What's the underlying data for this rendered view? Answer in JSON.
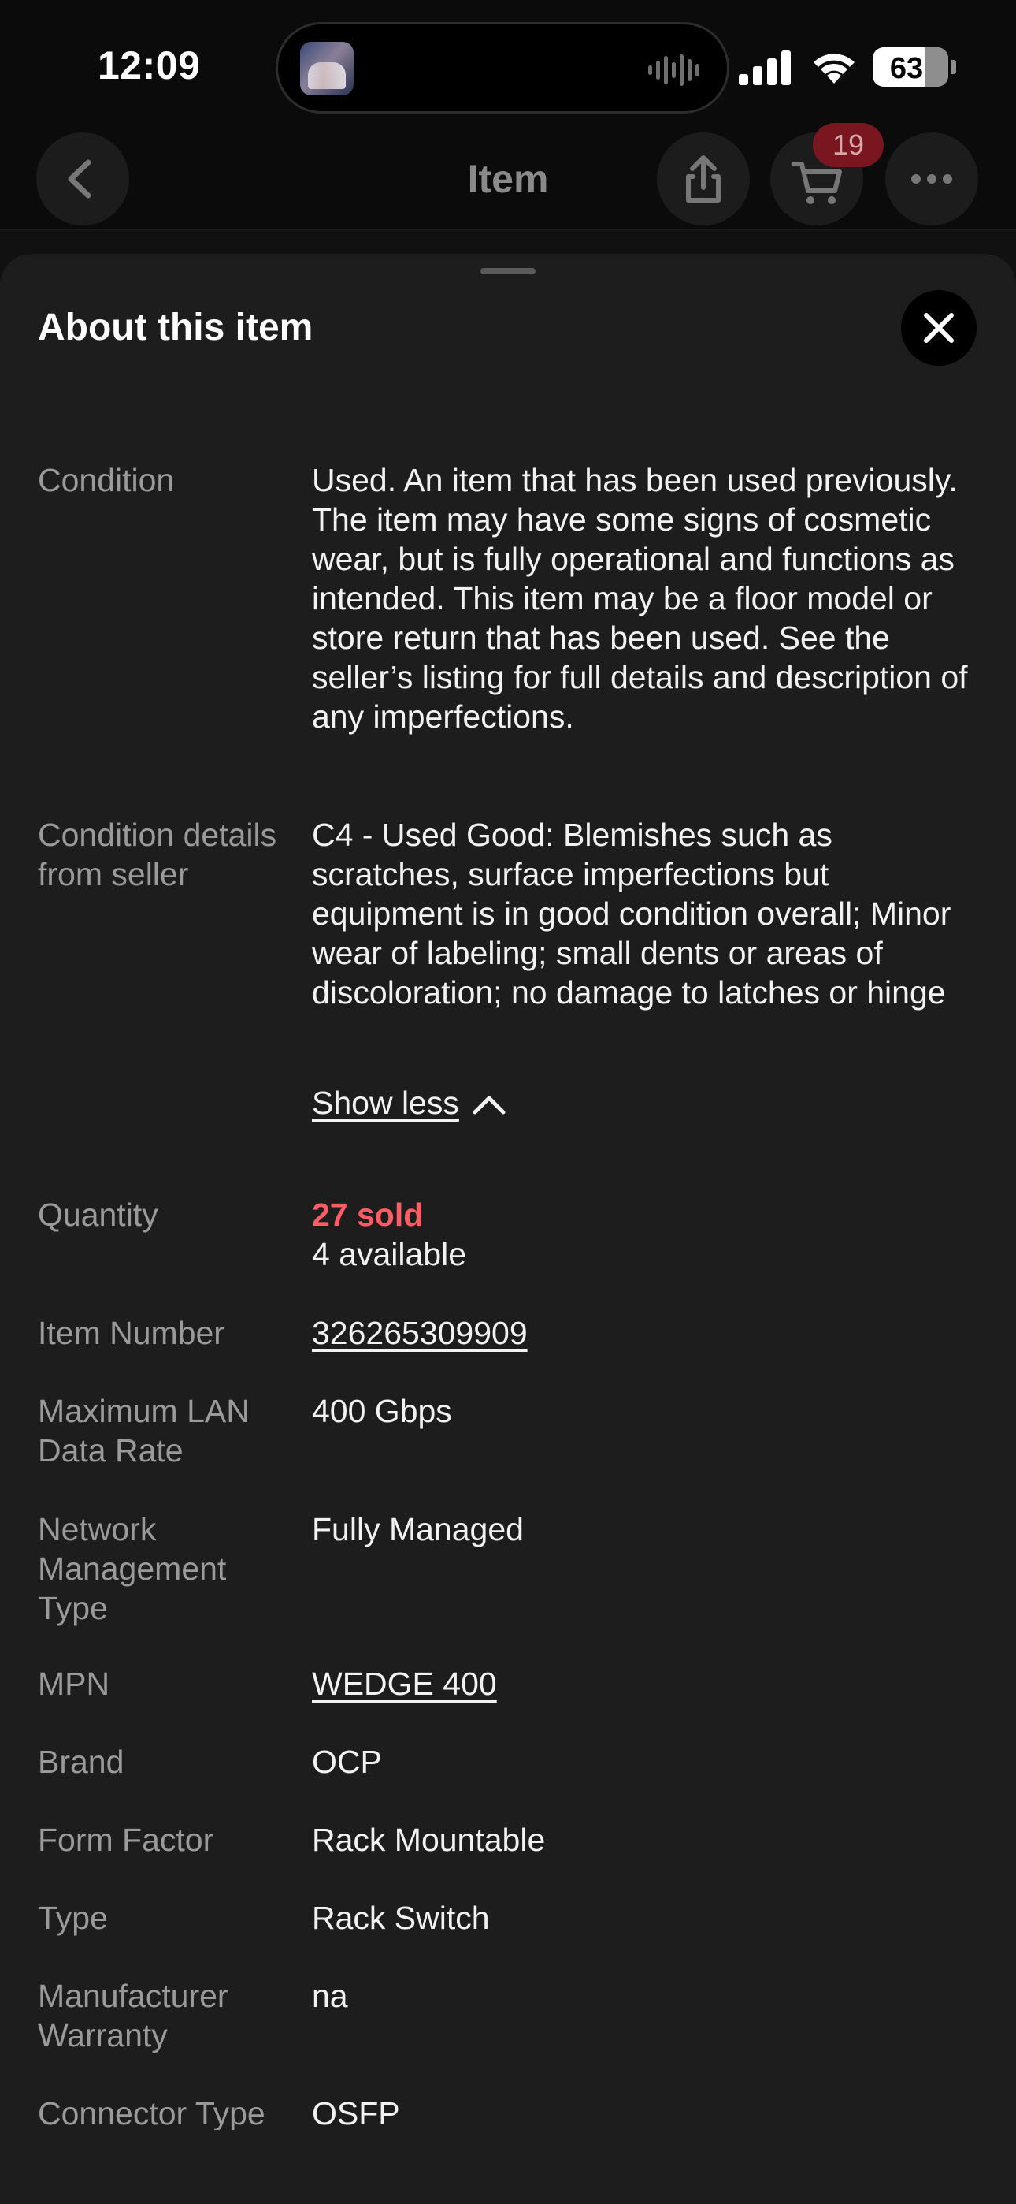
{
  "status_bar": {
    "time": "12:09",
    "battery": "63"
  },
  "nav": {
    "title": "Item",
    "cart_count": "19"
  },
  "sheet": {
    "title": "About this item",
    "show_less_label": "Show less",
    "specs": {
      "condition": {
        "label": "Condition",
        "value": "Used. An item that has been used previously. The item may have some signs of cosmetic wear, but is fully operational and functions as intended. This item may be a floor model or store return that has been used. See the seller’s listing for full details and description of any imperfections."
      },
      "condition_details": {
        "label": "Condition details from seller",
        "value": "C4 - Used Good: Blemishes such as scratches, surface imperfections but equipment is in good condition overall; Minor wear of labeling; small dents or areas of discoloration; no damage to latches or hinge"
      },
      "quantity": {
        "label": "Quantity",
        "sold": "27 sold",
        "available": "4 available"
      },
      "item_number": {
        "label": "Item Number",
        "value": "326265309909"
      },
      "max_lan_rate": {
        "label": "Maximum LAN Data Rate",
        "value": "400 Gbps"
      },
      "network_mgmt": {
        "label": "Network Management Type",
        "value": "Fully Managed"
      },
      "mpn": {
        "label": "MPN",
        "value": "WEDGE 400"
      },
      "brand": {
        "label": "Brand",
        "value": "OCP"
      },
      "form_factor": {
        "label": "Form Factor",
        "value": "Rack Mountable"
      },
      "type": {
        "label": "Type",
        "value": "Rack Switch"
      },
      "warranty": {
        "label": "Manufacturer Warranty",
        "value": "na"
      },
      "connector": {
        "label": "Connector Type",
        "value": "OSFP"
      }
    }
  },
  "colors": {
    "sold_accent": "#ff5c66",
    "sheet_bg": "#1d1d1e",
    "badge_bg": "#7a1620"
  }
}
